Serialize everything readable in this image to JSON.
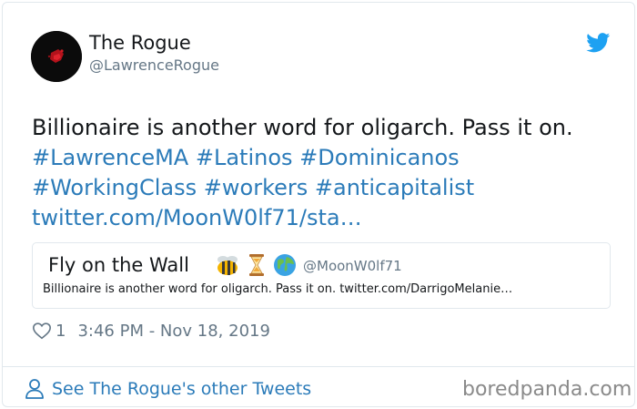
{
  "tweet": {
    "display_name": "The Rogue",
    "handle": "@LawrenceRogue",
    "text_plain": "Billionaire is another word for oligarch. Pass it on.",
    "hashtags_line1": [
      "#LawrenceMA",
      "#Latinos",
      "#Dominicanos"
    ],
    "hashtags_line2": [
      "#WorkingClass",
      "#workers",
      "#anticapitalist"
    ],
    "link": "twitter.com/MoonW0lf71/sta…",
    "like_count": "1",
    "timestamp": "3:46 PM - Nov 18, 2019",
    "icons": {
      "brand": "twitter-bird-icon",
      "like": "heart-icon",
      "profile": "person-icon"
    },
    "colors": {
      "link": "#2b7bb9",
      "brand": "#1da1f2",
      "muted": "#657786",
      "border": "#e1e8ed"
    }
  },
  "quote": {
    "display_name": "Fly on the Wall",
    "emojis": [
      "bee-emoji",
      "hourglass-emoji",
      "globe-emoji"
    ],
    "handle": "@MoonW0lf71",
    "text": "Billionaire is another word for oligarch. Pass it on. twitter.com/DarrigoMelanie…"
  },
  "footer": {
    "see_more_label": "See The Rogue's other Tweets",
    "watermark": "boredpanda.com"
  }
}
